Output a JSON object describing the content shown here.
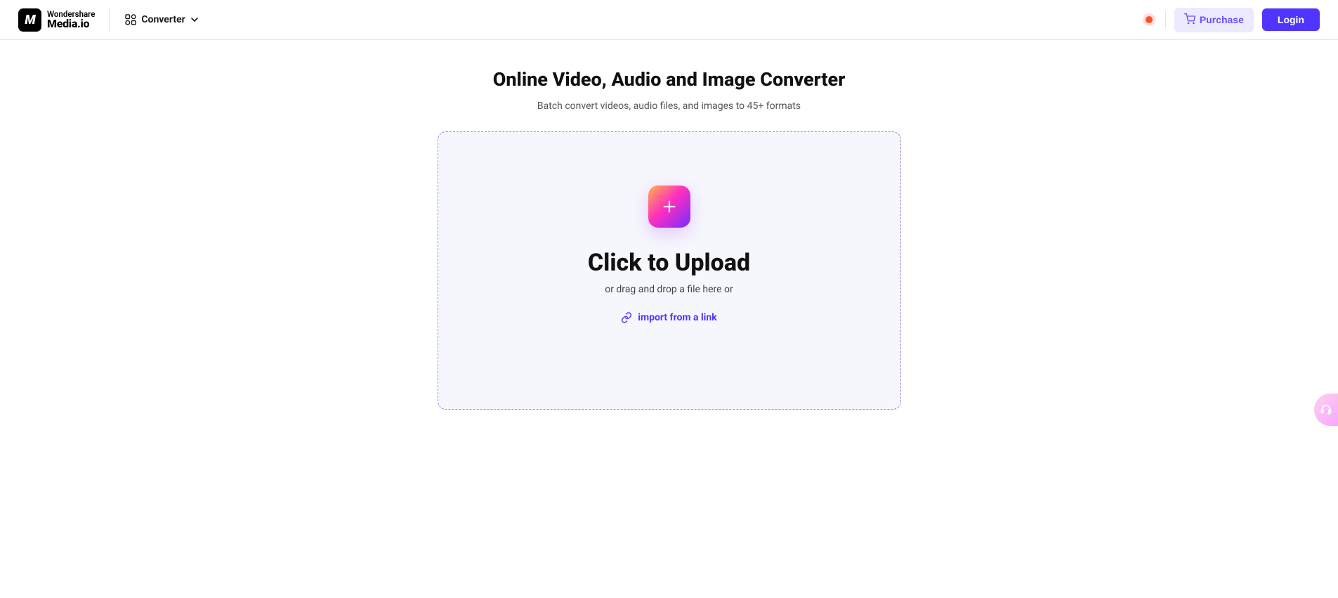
{
  "header": {
    "logo_line1": "Wondershare",
    "logo_line2": "Media.io",
    "nav_converter_label": "Converter",
    "purchase_label": "Purchase",
    "login_label": "Login"
  },
  "main": {
    "title": "Online Video, Audio and Image Converter",
    "subtitle": "Batch convert videos, audio files, and images to 45+ formats",
    "upload_title": "Click to Upload",
    "upload_sub": "or drag and drop a file here or",
    "import_link_label": "import from a link"
  }
}
